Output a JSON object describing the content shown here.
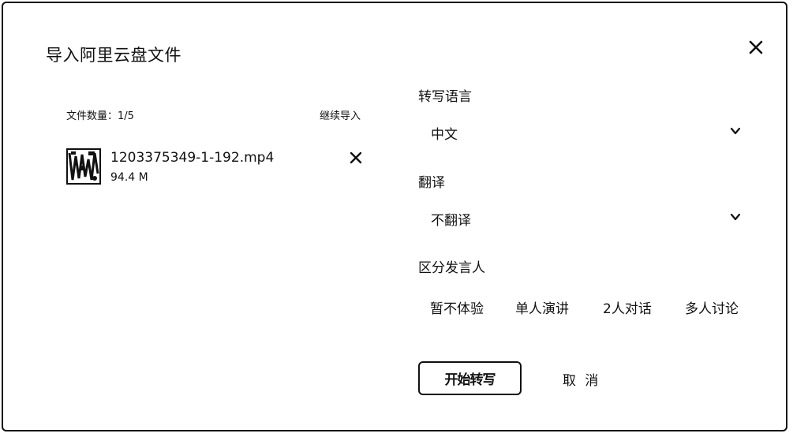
{
  "dialog": {
    "title": "导入阿里云盘文件",
    "close_icon": "close-icon"
  },
  "files": {
    "count_label": "文件数量：1/5",
    "continue_import": "继续导入",
    "items": [
      {
        "name": "1203375349-1-192.mp4",
        "size": "94.4 M",
        "remove_icon": "close-icon"
      }
    ]
  },
  "transcribe_language": {
    "label": "转写语言",
    "value": "中文",
    "icon": "chevron-down-icon"
  },
  "translate": {
    "label": "翻译",
    "value": "不翻译",
    "icon": "chevron-down-icon"
  },
  "speaker": {
    "label": "区分发言人",
    "options": [
      "暂不体验",
      "单人演讲",
      "2人对话",
      "多人讨论"
    ]
  },
  "actions": {
    "start": "开始转写",
    "cancel": "取 消"
  }
}
